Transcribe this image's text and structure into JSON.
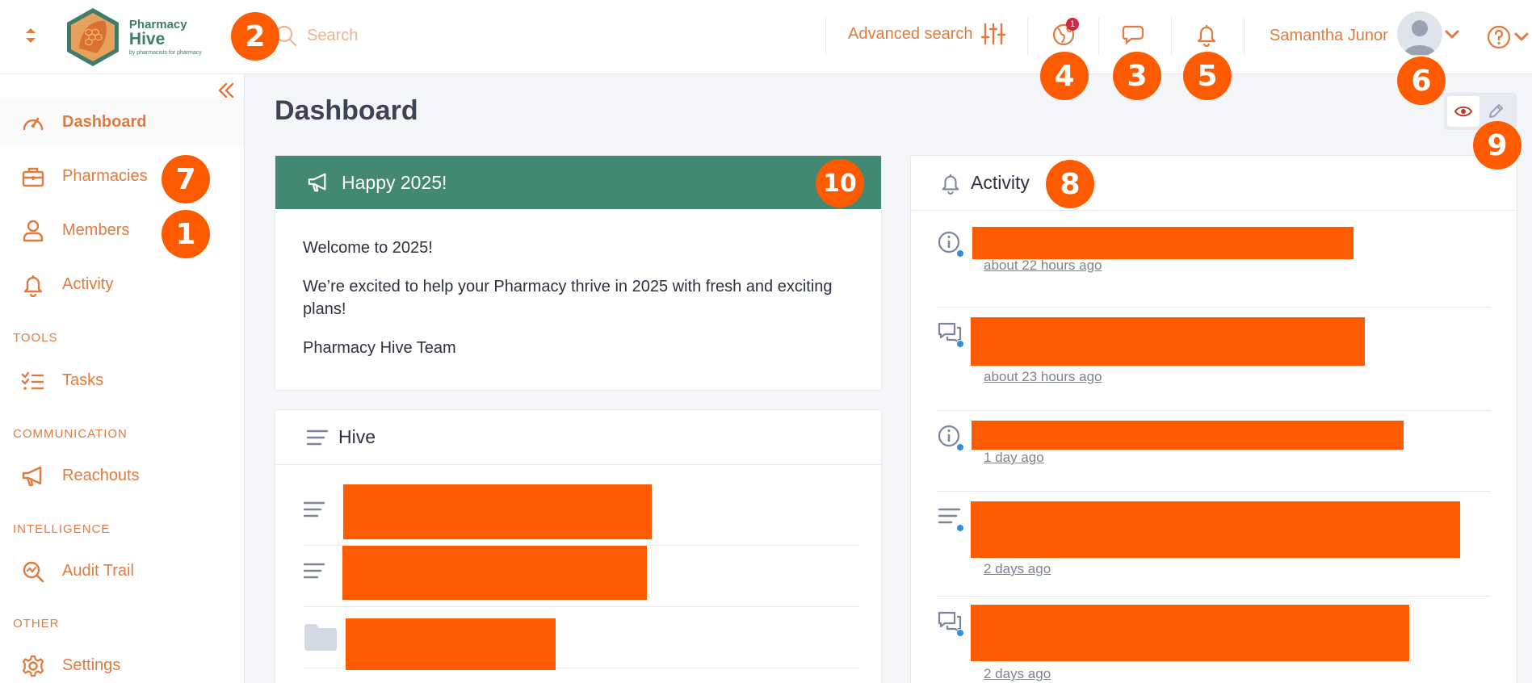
{
  "header": {
    "logo_line1": "Pharmacy",
    "logo_line1_bold": "Hive",
    "logo_line2": "by pharmacists for pharmacy",
    "search_placeholder": "Search",
    "advanced_search_label": "Advanced search",
    "notification_count": "1",
    "user_name": "Samantha Junor",
    "accent_color": "#e07a3e"
  },
  "sidebar": {
    "items": [
      {
        "label": "Dashboard",
        "icon": "gauge-icon"
      },
      {
        "label": "Pharmacies",
        "icon": "briefcase-icon"
      },
      {
        "label": "Members",
        "icon": "person-icon"
      },
      {
        "label": "Activity",
        "icon": "bell-icon"
      },
      {
        "label": "Tasks",
        "icon": "checklist-icon"
      },
      {
        "label": "Reachouts",
        "icon": "megaphone-icon"
      },
      {
        "label": "Audit Trail",
        "icon": "magnify-chart-icon"
      },
      {
        "label": "Settings",
        "icon": "gear-icon"
      }
    ],
    "sections": [
      "TOOLS",
      "COMMUNICATION",
      "INTELLIGENCE",
      "OTHER"
    ]
  },
  "main": {
    "page_title": "Dashboard",
    "announcement": {
      "title": "Happy 2025!",
      "paragraphs": [
        "Welcome to 2025!",
        "We’re excited to help your Pharmacy thrive in 2025 with fresh and exciting plans!",
        "Pharmacy Hive Team"
      ],
      "header_color": "#428872"
    },
    "hive": {
      "title": "Hive"
    },
    "activity": {
      "title": "Activity",
      "items": [
        {
          "icon": "info-icon",
          "time": "about 22 hours ago"
        },
        {
          "icon": "chat-icon",
          "time": "about 23 hours ago"
        },
        {
          "icon": "info-icon",
          "time": "1 day ago"
        },
        {
          "icon": "list-icon",
          "time": "2 days ago"
        },
        {
          "icon": "chat-icon",
          "time": "2 days ago"
        }
      ]
    }
  },
  "annotations": {
    "markers": [
      "1",
      "2",
      "3",
      "4",
      "5",
      "6",
      "7",
      "8",
      "9",
      "10"
    ],
    "color": "#fe5a00"
  }
}
